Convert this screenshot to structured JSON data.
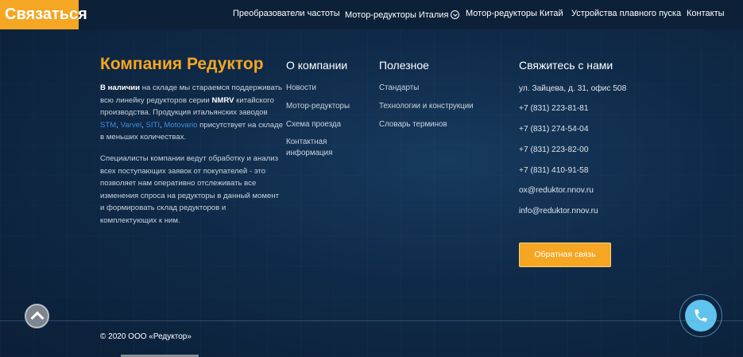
{
  "header": {
    "contact_label": "Связаться",
    "nav": [
      {
        "label": "Преобразователи частоты"
      },
      {
        "label": "Мотор-редукторы Италия"
      },
      {
        "label": "Мотор-редукторы Китай"
      },
      {
        "label": "Устройства плавного пуска"
      },
      {
        "label": "Контакты"
      }
    ]
  },
  "company": {
    "title": "Компания Редуктор",
    "para1": {
      "bold1": "В наличии",
      "text1": " на складе мы стараемся поддерживать всю линейку редукторов серии ",
      "bold2": "NMRV",
      "text2": " китайского производства. Продукция итальянских заводов ",
      "brands": [
        "STM",
        "Varvel",
        "SITI",
        "Motovario"
      ],
      "sep": ", ",
      "text3": " присутствует на складе в меньших количествах."
    },
    "para2": "Специалисты компании ведут обработку и анализ всех поступающих заявок от покупателей - это позволяет нам оперативно отслеживать все изменения спроса на редукторы в данный момент и формировать склад редукторов и комплектующих к ним."
  },
  "about": {
    "title": "О компании",
    "links": [
      "Новости",
      "Мотор-редукторы",
      "Схема проезда",
      "Контактная",
      "информация"
    ]
  },
  "useful": {
    "title": "Полезное",
    "links": [
      "Стандарты",
      "Технологии и конструкции",
      "Словарь терминов"
    ]
  },
  "contacts": {
    "title": "Свяжитесь с нами",
    "address": "ул. Зайцева, д. 31, офис 508",
    "phones": [
      "+7 (831) 223-81-81",
      "+7 (831) 274-54-04",
      "+7 (831) 223-82-00",
      "+7 (831) 410-91-58"
    ],
    "emails": [
      "ox@reduktor.nnov.ru",
      "info@reduktor.nnov.ru"
    ],
    "callback_label": "Обратная связь"
  },
  "footer": {
    "copyright": "© 2020 ООО «Редуктор»"
  },
  "icons": {
    "scroll_top": "chevron-up-icon",
    "phone": "phone-icon",
    "dropdown": "chevron-down-icon"
  },
  "colors": {
    "accent": "#f5a623",
    "link": "#3d8fe0",
    "background": "#0e2440",
    "phone_button": "#5fc3ee"
  }
}
